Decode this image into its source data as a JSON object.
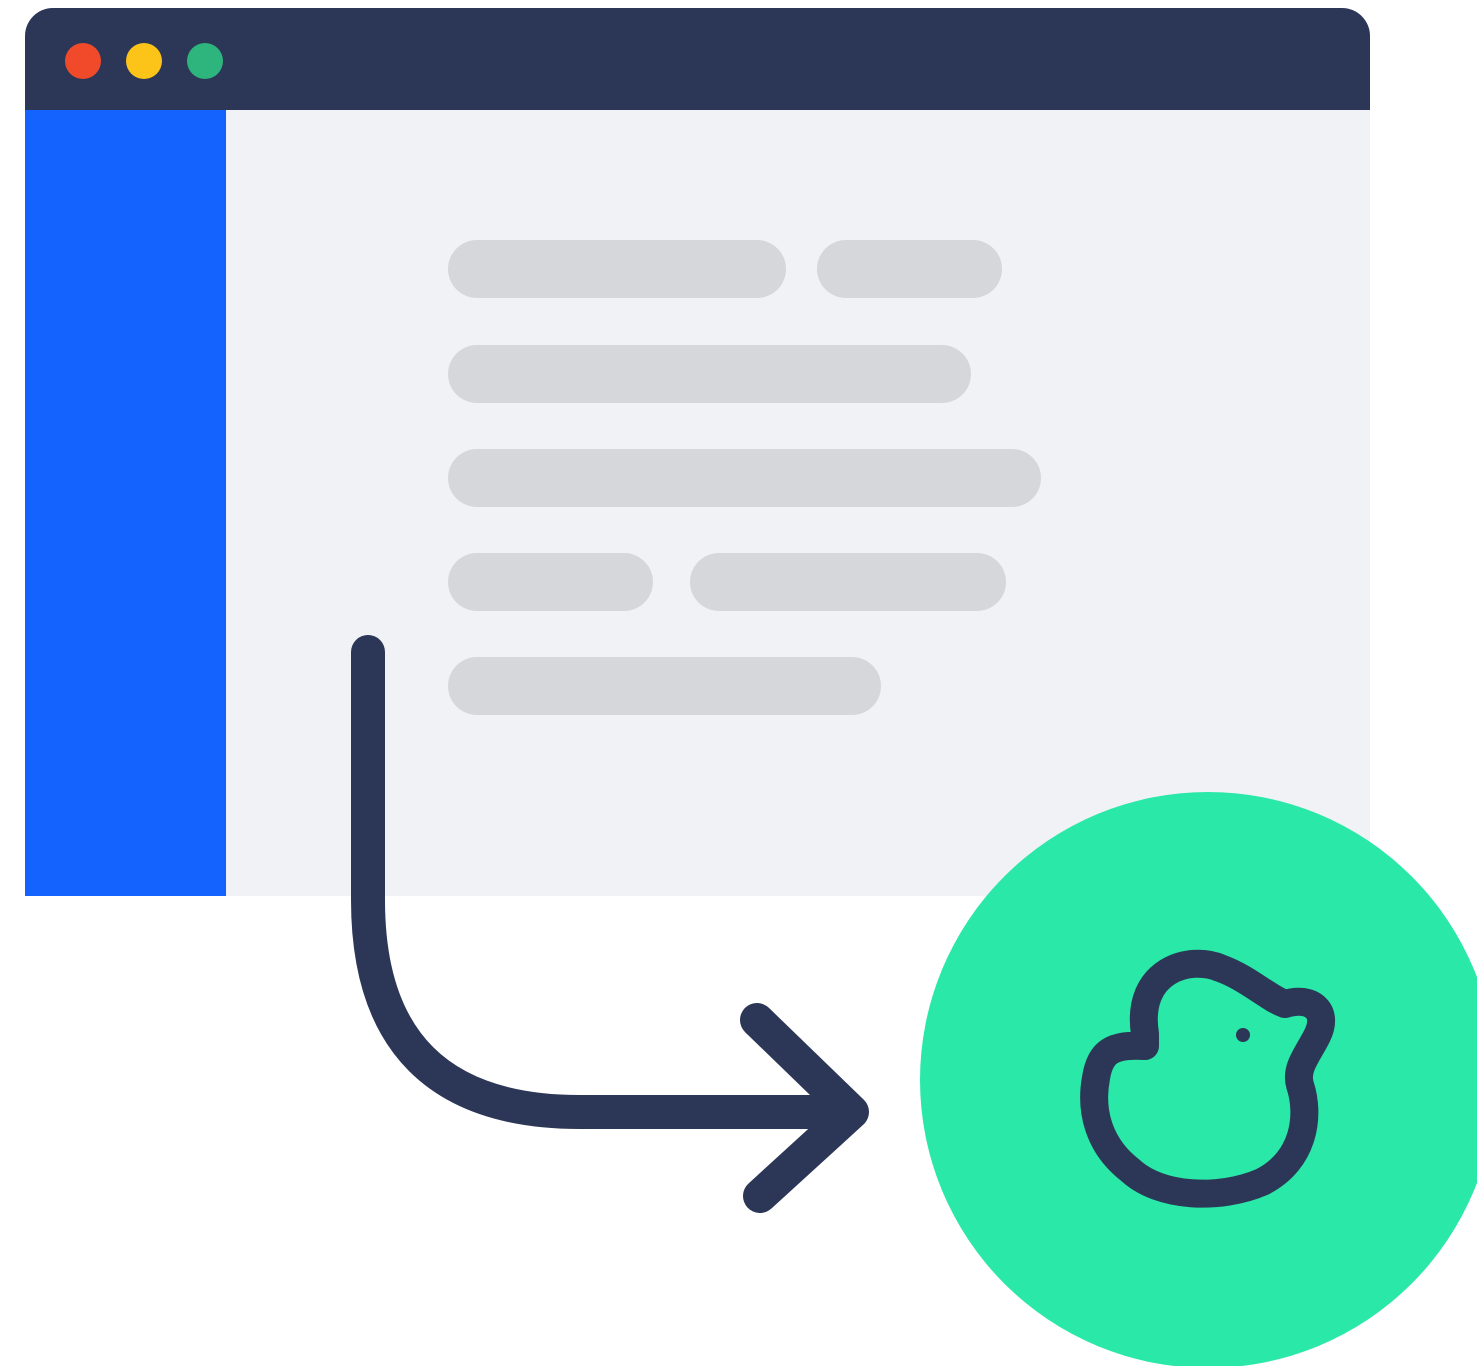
{
  "colors": {
    "titlebar": "#2c3757",
    "dot_close": "#f04a2a",
    "dot_minimize": "#fcc419",
    "dot_maximize": "#2db57d",
    "sidebar": "#1563ff",
    "content_bg": "#f1f2f6",
    "placeholder_bar": "#d6d7db",
    "arrow": "#2c3757",
    "badge": "#2ae8a8",
    "duck_outline": "#2c3757"
  },
  "icons": {
    "window_close": "red-dot",
    "window_minimize": "yellow-dot",
    "window_maximize": "green-dot",
    "flow_arrow": "curved-arrow-right",
    "badge_icon": "duck-icon"
  }
}
